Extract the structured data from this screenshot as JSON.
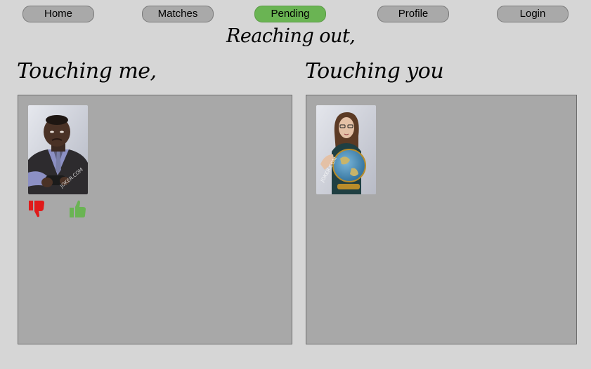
{
  "nav": {
    "home": "Home",
    "matches": "Matches",
    "pending": "Pending",
    "profile": "Profile",
    "login": "Login",
    "active": "pending"
  },
  "tagline": "Reaching out,",
  "columns": {
    "left": {
      "title": "Touching me,",
      "cards": [
        {
          "photo": "man-with-game-controller-photo",
          "actions": [
            "thumbs-down-icon",
            "thumbs-up-icon"
          ]
        }
      ]
    },
    "right": {
      "title": "Touching you",
      "cards": [
        {
          "photo": "woman-holding-globe-photo"
        }
      ]
    }
  },
  "colors": {
    "background": "#d6d6d6",
    "panel": "#a8a8a8",
    "nav_button": "#a9a9a9",
    "nav_active": "#6ab453",
    "thumbs_down": "#e01a1a",
    "thumbs_up": "#6ab453"
  }
}
